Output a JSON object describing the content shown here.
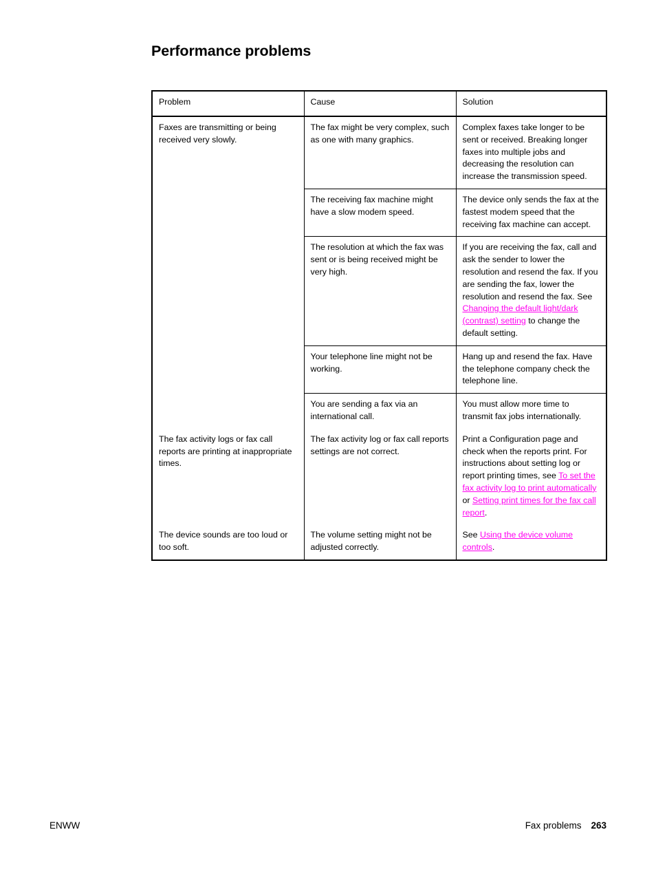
{
  "document": {
    "heading": "Performance problems",
    "link_color": "#FF00F0"
  },
  "table": {
    "headers": {
      "problem": "Problem",
      "cause": "Cause",
      "solution": "Solution"
    },
    "groups": [
      {
        "problem": "Faxes are transmitting or being received very slowly.",
        "rows": [
          {
            "cause": "The fax might be very complex, such as one with many graphics.",
            "solution_parts": [
              {
                "type": "text",
                "value": "Complex faxes take longer to be sent or received. Breaking longer faxes into multiple jobs and decreasing the resolution can increase the transmission speed."
              }
            ]
          },
          {
            "cause": "The receiving fax machine might have a slow modem speed.",
            "solution_parts": [
              {
                "type": "text",
                "value": "The device only sends the fax at the fastest modem speed that the receiving fax machine can accept."
              }
            ]
          },
          {
            "cause": "The resolution at which the fax was sent or is being received might be very high.",
            "solution_parts": [
              {
                "type": "text",
                "value": "If you are receiving the fax, call and ask the sender to lower the resolution and resend the fax. If you are sending the fax, lower the resolution and resend the fax. See "
              },
              {
                "type": "link",
                "value": "Changing the default light/dark (contrast) setting"
              },
              {
                "type": "text",
                "value": " to change the default setting."
              }
            ]
          },
          {
            "cause": "Your telephone line might not be working.",
            "solution_parts": [
              {
                "type": "text",
                "value": "Hang up and resend the fax. Have the telephone company check the telephone line."
              }
            ]
          },
          {
            "cause": "You are sending a fax via an international call.",
            "solution_parts": [
              {
                "type": "text",
                "value": "You must allow more time to transmit fax jobs internationally."
              }
            ]
          }
        ]
      },
      {
        "problem": "The fax activity logs or fax call reports are printing at inappropriate times.",
        "rows": [
          {
            "cause": "The fax activity log or fax call reports settings are not correct.",
            "solution_parts": [
              {
                "type": "text",
                "value": "Print a Configuration page and check when the reports print. For instructions about setting log or report printing times, see "
              },
              {
                "type": "link",
                "value": "To set the fax activity log to print automatically"
              },
              {
                "type": "text",
                "value": " or "
              },
              {
                "type": "link",
                "value": "Setting print times for the fax call report"
              },
              {
                "type": "text",
                "value": "."
              }
            ]
          }
        ]
      },
      {
        "problem": "The device sounds are too loud or too soft.",
        "rows": [
          {
            "cause": "The volume setting might not be adjusted correctly.",
            "solution_parts": [
              {
                "type": "text",
                "value": "See "
              },
              {
                "type": "link",
                "value": "Using the device volume controls"
              },
              {
                "type": "text",
                "value": "."
              }
            ]
          }
        ]
      }
    ]
  },
  "footer": {
    "left": "ENWW",
    "section": "Fax problems",
    "page_number": "263"
  }
}
